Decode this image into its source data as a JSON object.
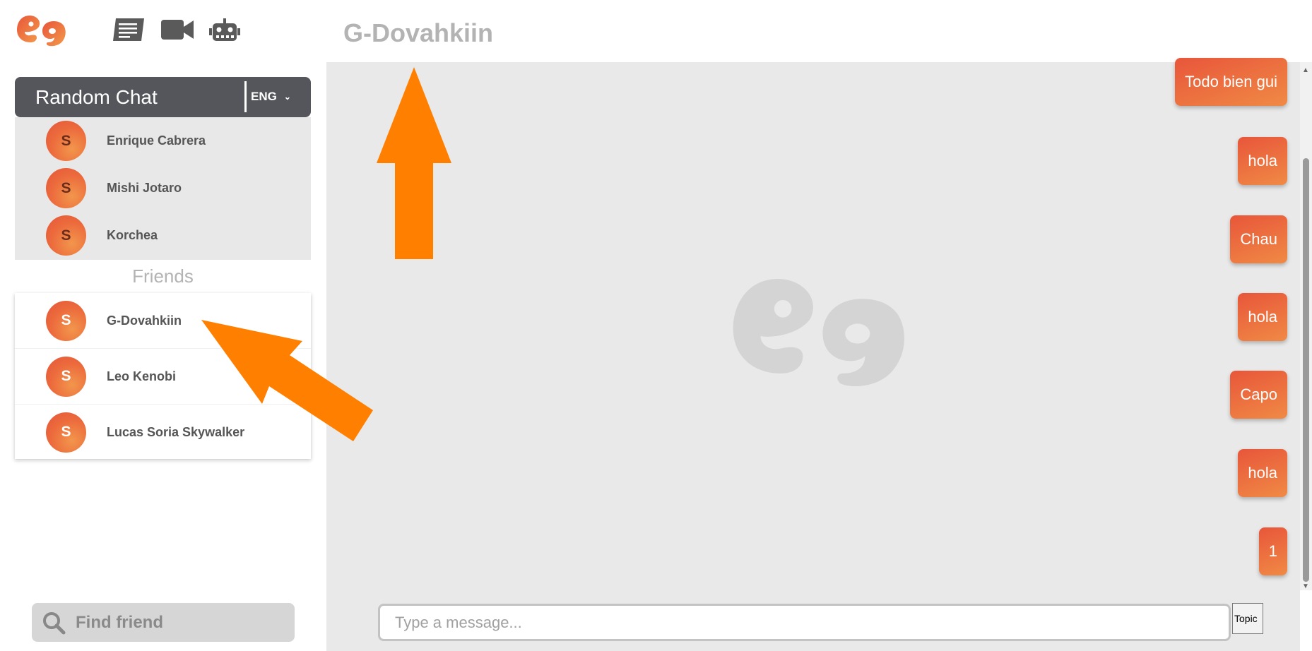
{
  "header": {
    "chat_title": "G-Dovahkiin"
  },
  "nav": {
    "icons": [
      "chat-lines-icon",
      "video-camera-icon",
      "robot-icon"
    ]
  },
  "random_chat": {
    "title": "Random Chat",
    "language": "ENG",
    "users": [
      {
        "initial": "S",
        "name": "Enrique Cabrera"
      },
      {
        "initial": "S",
        "name": "Mishi Jotaro"
      },
      {
        "initial": "S",
        "name": "Korchea"
      }
    ]
  },
  "friends": {
    "label": "Friends",
    "users": [
      {
        "initial": "S",
        "name": "G-Dovahkiin"
      },
      {
        "initial": "S",
        "name": "Leo Kenobi"
      },
      {
        "initial": "S",
        "name": "Lucas Soria Skywalker"
      }
    ]
  },
  "search": {
    "placeholder": "Find friend"
  },
  "messages": [
    {
      "text": "Todo bien gui"
    },
    {
      "text": "hola"
    },
    {
      "text": "Chau"
    },
    {
      "text": "hola"
    },
    {
      "text": "Capo"
    },
    {
      "text": "hola"
    },
    {
      "text": "1"
    }
  ],
  "composer": {
    "placeholder": "Type a message...",
    "topic_label": "Topic"
  },
  "colors": {
    "accent": "#ec6a3c",
    "accent_light": "#f2964c",
    "sidebar_header": "#55565b",
    "annotation_arrow": "#ff8000"
  }
}
